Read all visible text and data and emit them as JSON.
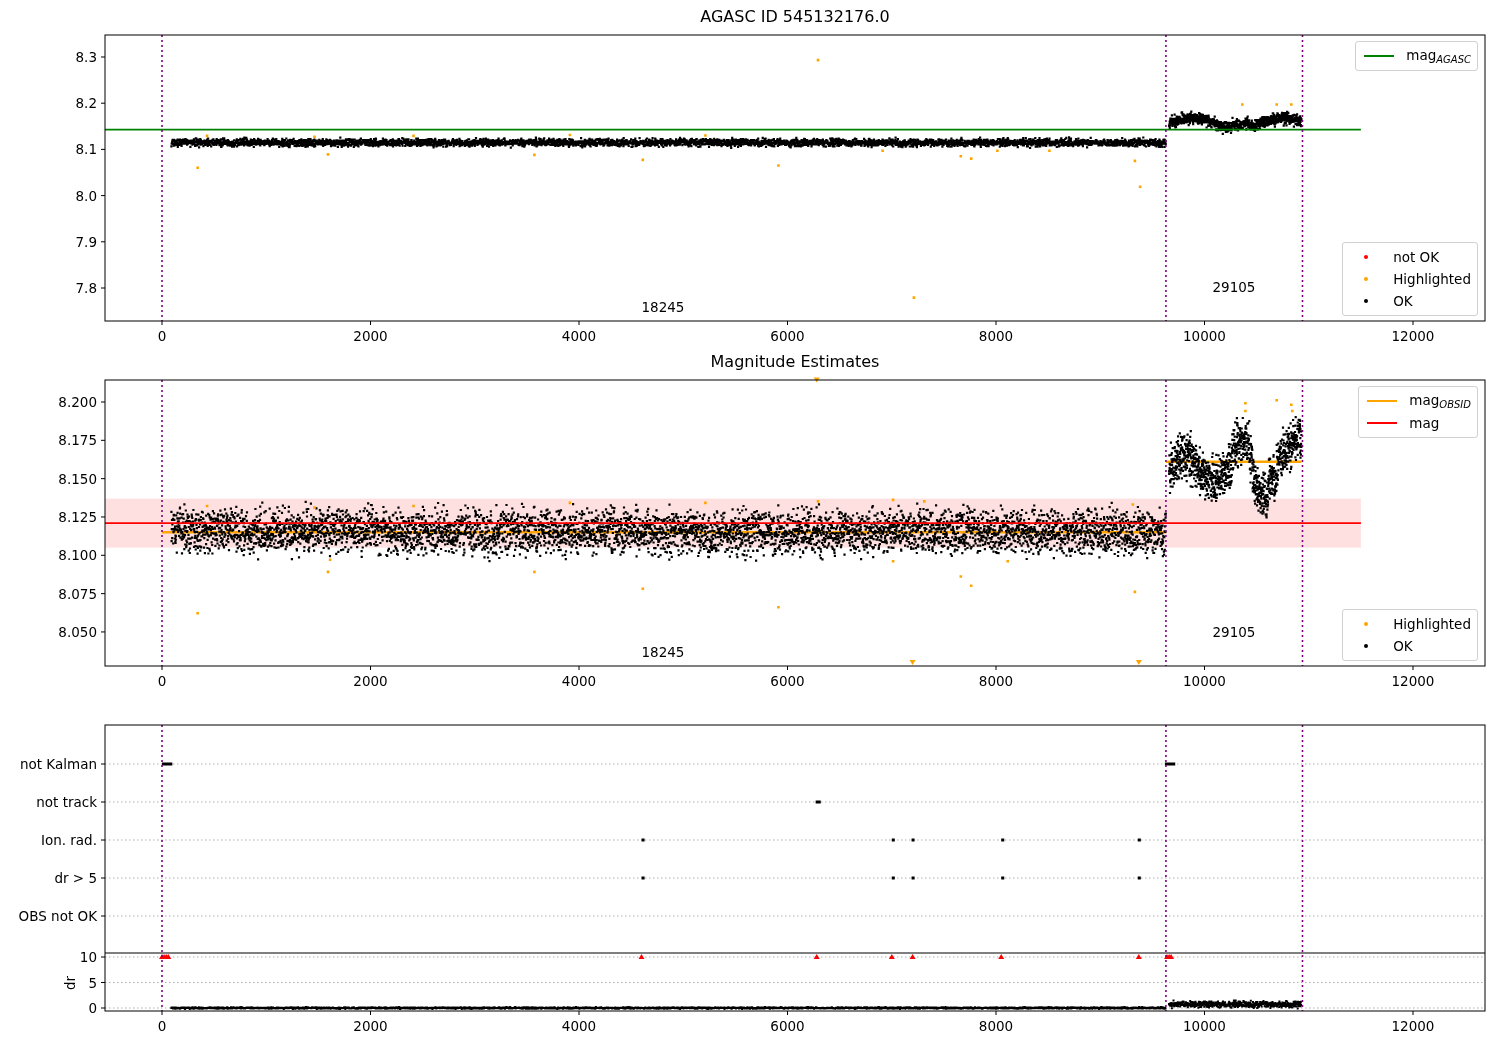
{
  "figure": {
    "panels": [
      {
        "title": "AGASC ID 545132176.0",
        "yticks": [
          "8.3",
          "8.2",
          "8.1",
          "8.0",
          "7.9",
          "7.8"
        ],
        "xticks": [
          "0",
          "2000",
          "4000",
          "6000",
          "8000",
          "10000",
          "12000"
        ],
        "obsid_labels": [
          "18245",
          "29105"
        ],
        "legends": [
          [
            {
              "kind": "line",
              "color": "#008000",
              "label": "mag$_{AGASC}$"
            }
          ],
          [
            {
              "kind": "dot",
              "color": "#ff0000",
              "label": "not OK"
            },
            {
              "kind": "dot",
              "color": "#ffa500",
              "label": "Highlighted"
            },
            {
              "kind": "dot",
              "color": "#000000",
              "label": "OK"
            }
          ]
        ]
      },
      {
        "title": "Magnitude Estimates",
        "yticks": [
          "8.200",
          "8.175",
          "8.150",
          "8.125",
          "8.100",
          "8.075",
          "8.050"
        ],
        "xticks": [
          "0",
          "2000",
          "4000",
          "6000",
          "8000",
          "10000",
          "12000"
        ],
        "obsid_labels": [
          "18245",
          "29105"
        ],
        "legends": [
          [
            {
              "kind": "line",
              "color": "#ffa500",
              "label": "mag$_{OBSID}$"
            },
            {
              "kind": "line",
              "color": "#ff0000",
              "label": "mag"
            }
          ],
          [
            {
              "kind": "dot",
              "color": "#ffa500",
              "label": "Highlighted"
            },
            {
              "kind": "dot",
              "color": "#000000",
              "label": "OK"
            }
          ]
        ]
      },
      {
        "flags": [
          "not Kalman",
          "not track",
          "Ion. rad.",
          "dr > 5",
          "OBS not OK"
        ],
        "ylabel": "dr",
        "yticks": [
          "10",
          "5",
          "0"
        ],
        "xticks": [
          "0",
          "2000",
          "4000",
          "6000",
          "8000",
          "10000",
          "12000"
        ]
      }
    ]
  }
}
